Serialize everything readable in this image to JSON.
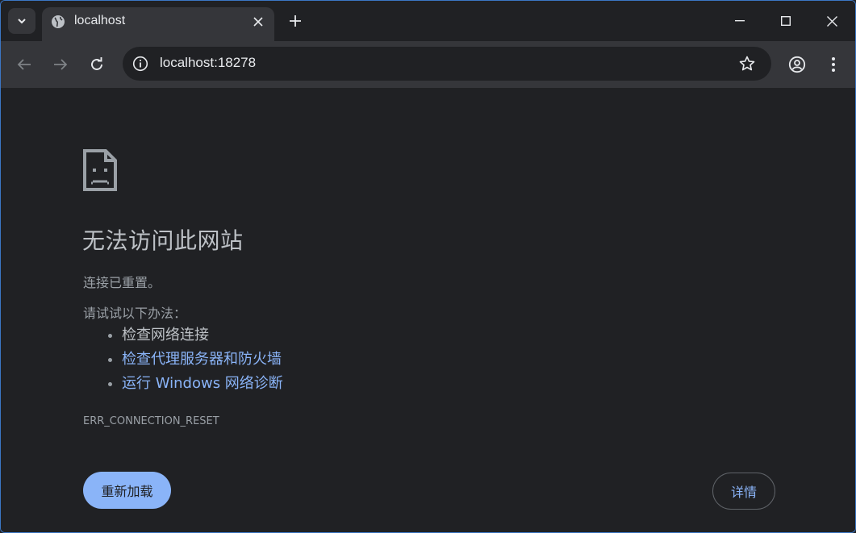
{
  "tab": {
    "title": "localhost"
  },
  "toolbar": {
    "url": "localhost:18278"
  },
  "error": {
    "heading": "无法访问此网站",
    "message": "连接已重置。",
    "try_label": "请试试以下办法：",
    "suggestions": [
      {
        "text": "检查网络连接",
        "link": false
      },
      {
        "text": "检查代理服务器和防火墙",
        "link": true
      },
      {
        "text": "运行 Windows 网络诊断",
        "link": true
      }
    ],
    "code": "ERR_CONNECTION_RESET",
    "reload_label": "重新加载",
    "details_label": "详情"
  },
  "colors": {
    "link": "#8ab4f8",
    "background": "#202124",
    "toolbar": "#35363a"
  },
  "icons": [
    "tab-search-icon",
    "globe-icon",
    "close-icon",
    "plus-icon",
    "minimize-icon",
    "maximize-icon",
    "window-close-icon",
    "back-icon",
    "forward-icon",
    "reload-icon",
    "info-icon",
    "star-icon",
    "profile-icon",
    "menu-icon",
    "sad-page-icon"
  ]
}
